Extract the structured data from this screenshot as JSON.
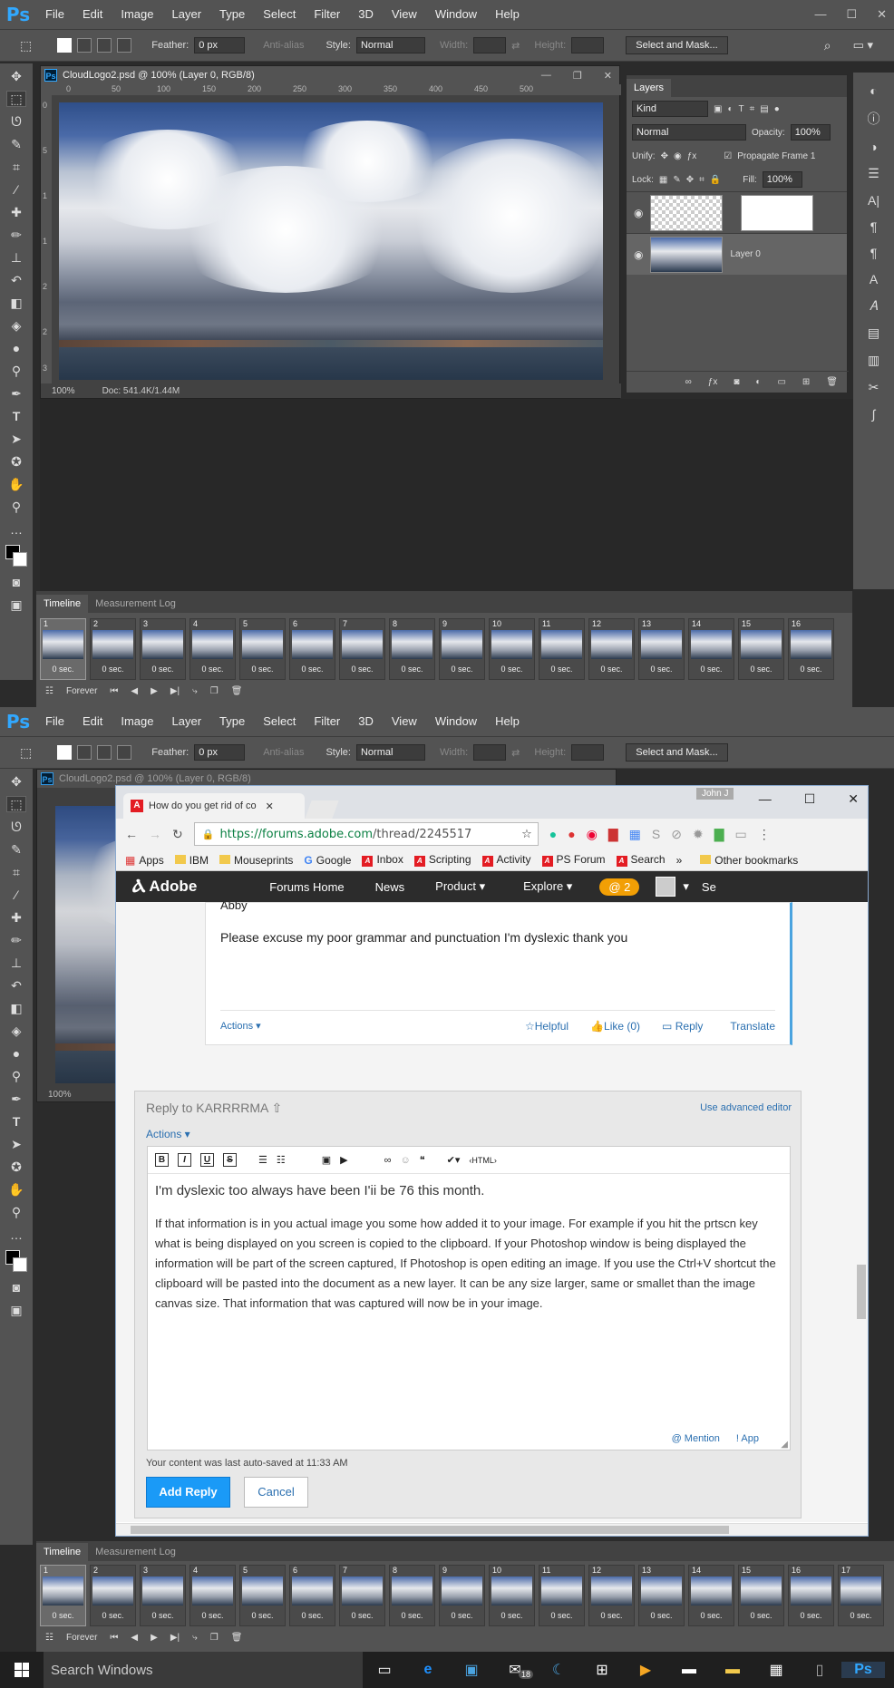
{
  "app": {
    "logo": "Ps",
    "menu": [
      "File",
      "Edit",
      "Image",
      "Layer",
      "Type",
      "Select",
      "Filter",
      "3D",
      "View",
      "Window",
      "Help"
    ]
  },
  "options": {
    "feather_label": "Feather:",
    "feather_value": "0 px",
    "anti_alias": "Anti-alias",
    "style_label": "Style:",
    "style_value": "Normal",
    "width_label": "Width:",
    "height_label": "Height:",
    "select_mask": "Select and Mask..."
  },
  "doc": {
    "title": "CloudLogo2.psd @ 100% (Layer 0, RGB/8)",
    "zoom": "100%",
    "docinfo": "Doc: 541.4K/1.44M",
    "ruler_h": [
      "0",
      "50",
      "100",
      "150",
      "200",
      "250",
      "300",
      "350",
      "400",
      "450",
      "500"
    ],
    "ruler_v": [
      "0",
      "5",
      "1",
      "1",
      "2",
      "2",
      "3"
    ]
  },
  "layers": {
    "tab": "Layers",
    "kind": "Kind",
    "blend": "Normal",
    "opacity_label": "Opacity:",
    "opacity": "100%",
    "unify": "Unify:",
    "propagate": "Propagate Frame 1",
    "lock": "Lock:",
    "fill_label": "Fill:",
    "fill": "100%",
    "layer0": "Layer 0"
  },
  "timeline": {
    "tab1": "Timeline",
    "tab2": "Measurement Log",
    "loop": "Forever",
    "frame_delay": "0 sec.",
    "frames_top": [
      "1",
      "2",
      "3",
      "4",
      "5",
      "6",
      "7",
      "8",
      "9",
      "10",
      "11",
      "12",
      "13",
      "14",
      "15",
      "16",
      "1"
    ],
    "frames_bottom": [
      "1",
      "2",
      "3",
      "4",
      "5",
      "6",
      "7",
      "8",
      "9",
      "10",
      "11",
      "12",
      "13",
      "14",
      "15",
      "16",
      "17"
    ]
  },
  "browser": {
    "tab_title": "How do you get rid of co",
    "user": "John J",
    "url_host": "https://forums.adobe.com",
    "url_path": "/thread/2245517",
    "bookmarks": [
      "Apps",
      "IBM",
      "Mouseprints",
      "Google",
      "Inbox",
      "Scripting",
      "Activity",
      "PS Forum",
      "Search",
      "»",
      "Other bookmarks"
    ],
    "nav": {
      "brand": "Adobe",
      "items": [
        "Forums Home",
        "News",
        "Product ▾",
        "Explore ▾"
      ],
      "badge": "@ 2",
      "se": "Se"
    },
    "post": {
      "sig": "Abby",
      "text": "Please excuse my poor grammar and punctuation I'm dyslexic thank you",
      "actions": "Actions ▾",
      "helpful": "Helpful",
      "like": "Like (0)",
      "reply": "Reply",
      "translate": "Translate"
    },
    "reply_box": {
      "heading": "Reply to KARRRRMA",
      "advanced": "Use advanced editor",
      "actions": "Actions ▾",
      "html_label": "‹HTML›",
      "line1": "I'm dyslexic too always have been I'ii be 76 this month.",
      "para": "If that information is in you actual image you some how added it to your image. For example if you hit the prtscn key what is being displayed on you screen is copied to the clipboard.  If your Photoshop window is being displayed the information will be part of the screen captured,  If Photoshop is open editing an image.  If you use the Ctrl+V shortcut the clipboard will be pasted into the document as a new layer.  It  can be any size larger, same or smallet than the image canvas size. That information that was captured will now be in your image.",
      "mention": "@ Mention",
      "app": "! App",
      "autosave": "Your content was last auto-saved at 11:33 AM",
      "add_reply": "Add Reply",
      "cancel": "Cancel"
    }
  },
  "taskbar": {
    "search": "Search Windows",
    "mail_badge": "18"
  }
}
